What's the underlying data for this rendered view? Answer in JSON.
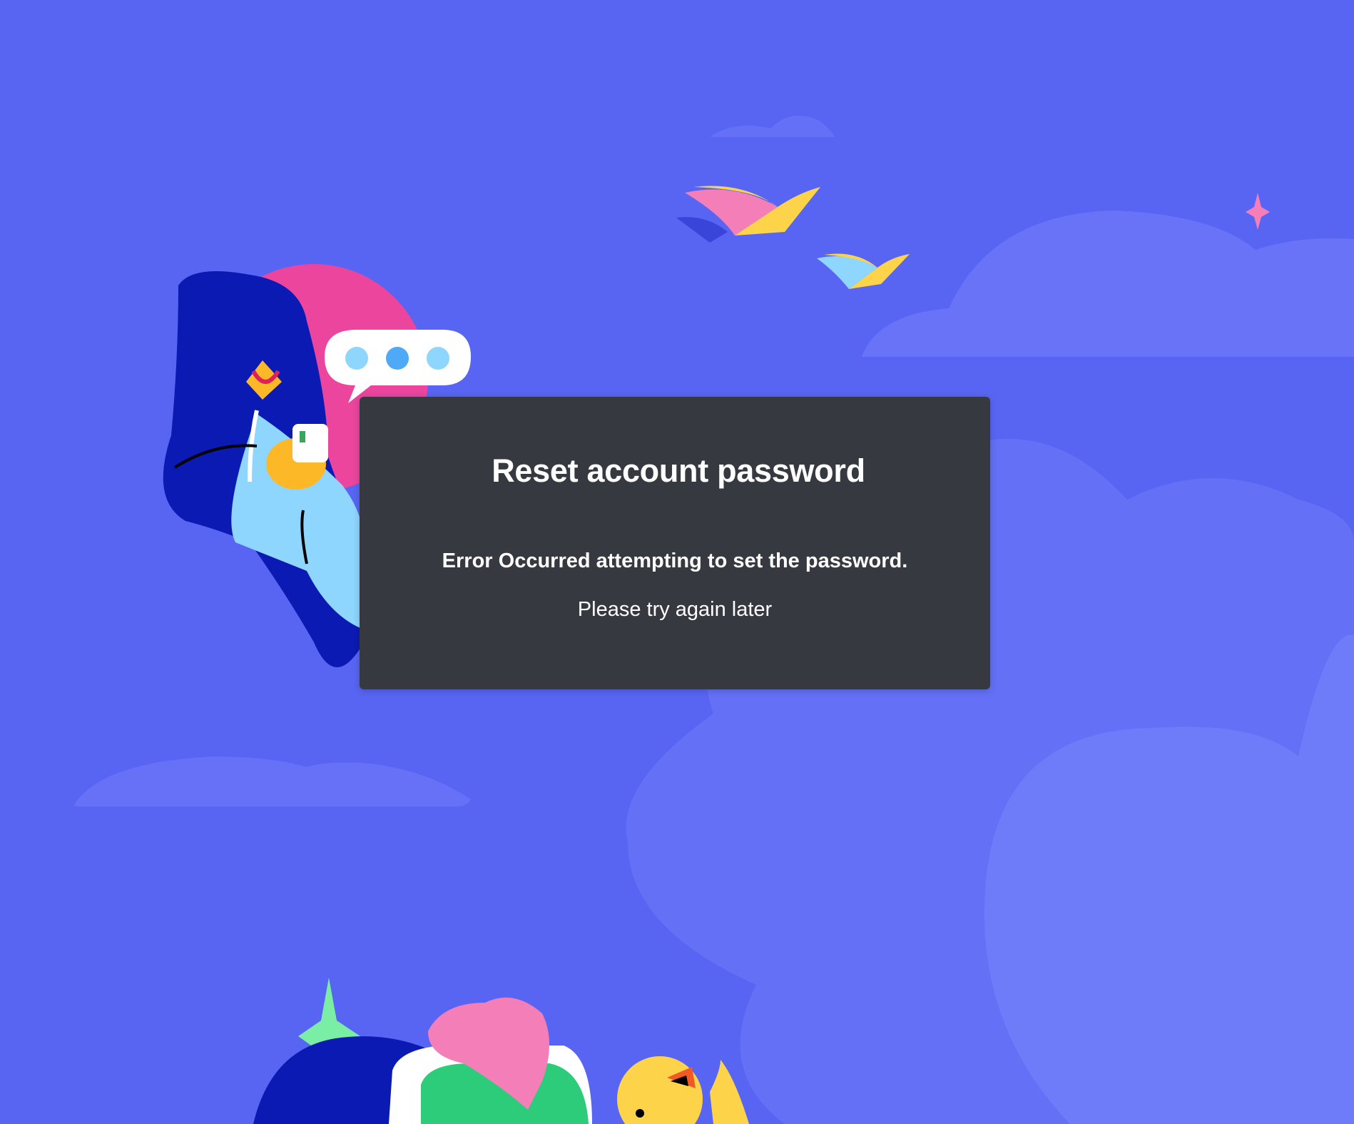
{
  "page": {
    "background_color": "#5865f2",
    "card_color": "#36393f"
  },
  "dialog": {
    "title": "Reset account password",
    "error_message": "Error Occurred attempting to set the password.",
    "hint_message": "Please try again later"
  },
  "illustration": {
    "icons": [
      "cloud-icon",
      "flying-book-icon",
      "sparkle-icon",
      "chat-bubble-icon",
      "character-with-phone-illustration",
      "duck-illustration"
    ]
  }
}
